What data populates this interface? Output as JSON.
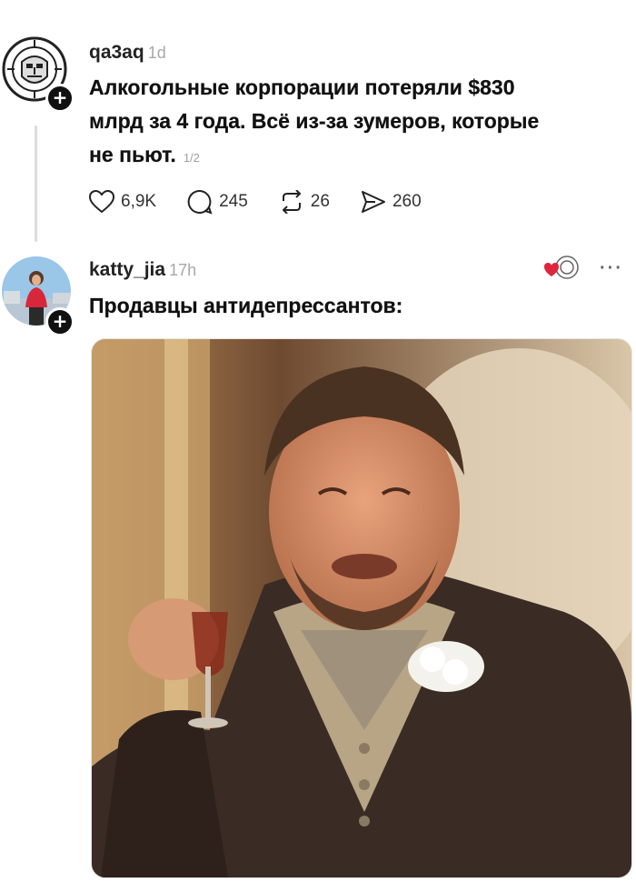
{
  "post1": {
    "username": "qa3aq",
    "time": "1d",
    "text_lines": [
      "Алкогольные корпорации потеряли $830",
      "млрд за 4 года. Всё из-за зумеров, которые",
      "не пьют."
    ],
    "page_indicator": "1/2",
    "actions": {
      "likes": "6,9K",
      "comments": "245",
      "reposts": "26",
      "shares": "260"
    }
  },
  "post2": {
    "username": "katty_jia",
    "time": "17h",
    "text": "Продавцы антидепрессантов:",
    "more": "···"
  },
  "icons": [
    "heart-icon",
    "comment-icon",
    "repost-icon",
    "share-icon",
    "plus-icon",
    "more-icon"
  ],
  "colors": {
    "accent_red": "#e0263c",
    "muted": "#a8a8a8"
  }
}
